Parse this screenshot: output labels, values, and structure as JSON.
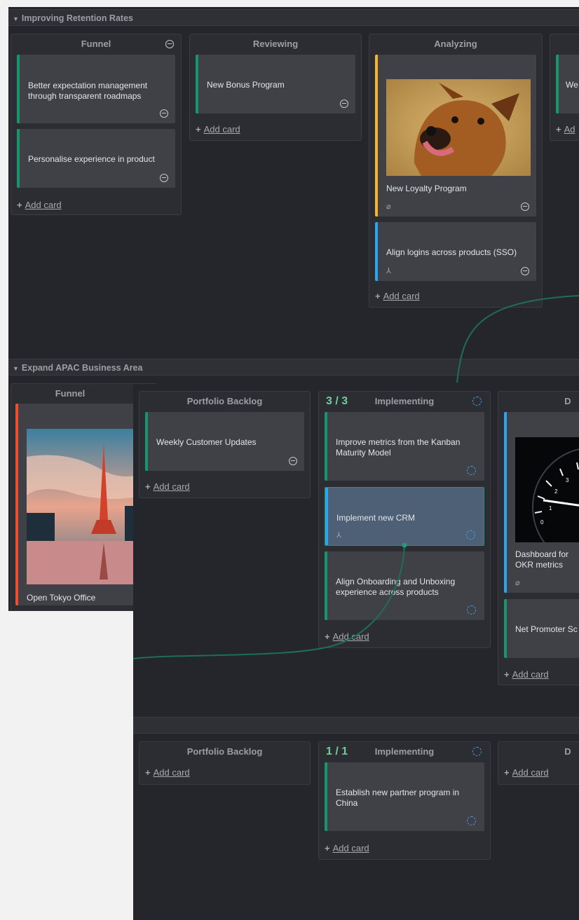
{
  "top": {
    "lane_title": "Improving Retention Rates",
    "columns": {
      "funnel": {
        "title": "Funnel",
        "cards": [
          "Better expectation management through transparent roadmaps",
          "Personalise experience in product"
        ]
      },
      "reviewing": {
        "title": "Reviewing",
        "cards": [
          "New Bonus Program"
        ]
      },
      "analyzing": {
        "title": "Analyzing",
        "cards": [
          "New Loyalty Program",
          "Align logins across products (SSO)"
        ]
      },
      "partial": {
        "card_text": "We"
      }
    }
  },
  "apac": {
    "lane_title": "Expand APAC Business Area",
    "funnel": {
      "title": "Funnel",
      "card": "Open Tokyo Office"
    }
  },
  "front": {
    "row1": {
      "portfolio": {
        "title": "Portfolio Backlog",
        "cards": [
          "Weekly Customer Updates"
        ]
      },
      "implementing": {
        "wip": "3 / 3",
        "title": "Implementing",
        "cards": [
          "Improve metrics from the Kanban Maturity Model",
          "Implement new CRM",
          "Align Onboarding and Unboxing experience across products"
        ]
      },
      "done": {
        "title": "D",
        "cards": [
          "Dashboard for OKR metrics",
          "Net Promoter Sc"
        ]
      }
    },
    "row2": {
      "portfolio": {
        "title": "Portfolio Backlog"
      },
      "implementing": {
        "wip": "1 / 1",
        "title": "Implementing",
        "cards": [
          "Establish new partner program in China"
        ]
      },
      "done": {
        "title": "D"
      }
    }
  },
  "add_card": "Add card",
  "colors": {
    "green": "#16966b",
    "yellow": "#f2b632",
    "blue": "#2aa7ec",
    "red": "#ef4d2e",
    "wip": "#6fcf97",
    "connector": "#1f6e56"
  }
}
